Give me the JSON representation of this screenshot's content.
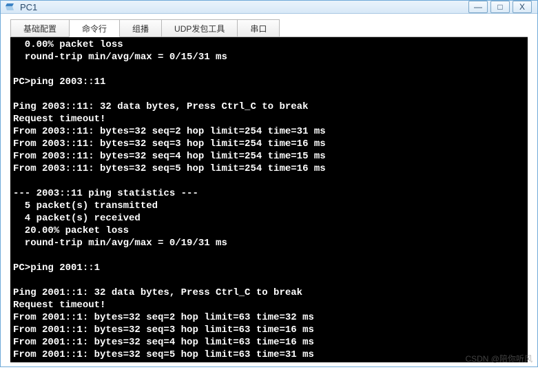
{
  "window": {
    "title": "PC1",
    "buttons": {
      "min": "—",
      "max": "□",
      "close": "X"
    }
  },
  "tabs": [
    {
      "label": "基础配置",
      "active": false
    },
    {
      "label": "命令行",
      "active": true
    },
    {
      "label": "组播",
      "active": false
    },
    {
      "label": "UDP发包工具",
      "active": false
    },
    {
      "label": "串口",
      "active": false
    }
  ],
  "terminal": {
    "lines": [
      "  0.00% packet loss",
      "  round-trip min/avg/max = 0/15/31 ms",
      "",
      "PC>ping 2003::11",
      "",
      "Ping 2003::11: 32 data bytes, Press Ctrl_C to break",
      "Request timeout!",
      "From 2003::11: bytes=32 seq=2 hop limit=254 time=31 ms",
      "From 2003::11: bytes=32 seq=3 hop limit=254 time=16 ms",
      "From 2003::11: bytes=32 seq=4 hop limit=254 time=15 ms",
      "From 2003::11: bytes=32 seq=5 hop limit=254 time=16 ms",
      "",
      "--- 2003::11 ping statistics ---",
      "  5 packet(s) transmitted",
      "  4 packet(s) received",
      "  20.00% packet loss",
      "  round-trip min/avg/max = 0/19/31 ms",
      "",
      "PC>ping 2001::1",
      "",
      "Ping 2001::1: 32 data bytes, Press Ctrl_C to break",
      "Request timeout!",
      "From 2001::1: bytes=32 seq=2 hop limit=63 time=32 ms",
      "From 2001::1: bytes=32 seq=3 hop limit=63 time=16 ms",
      "From 2001::1: bytes=32 seq=4 hop limit=63 time=16 ms",
      "From 2001::1: bytes=32 seq=5 hop limit=63 time=31 ms"
    ]
  },
  "watermark": "CSDN @陪你听风"
}
